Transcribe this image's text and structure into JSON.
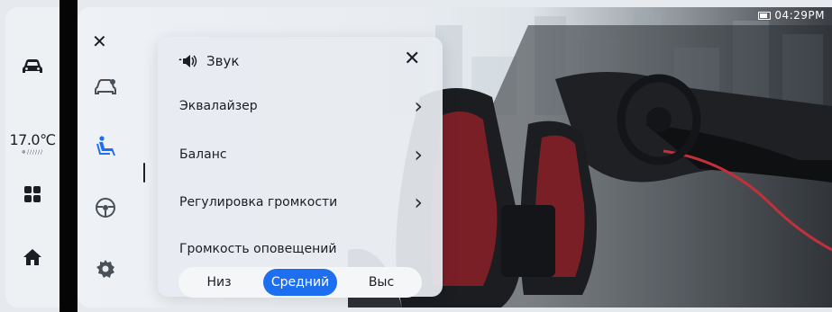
{
  "status_bar": {
    "time": "04:29PM",
    "battery_icon": "battery-icon"
  },
  "dock": {
    "items": [
      {
        "name": "car-icon"
      },
      {
        "name": "apps-grid-icon"
      },
      {
        "name": "home-icon"
      }
    ],
    "temperature": "17.0℃",
    "temperature_sub": "❄//////"
  },
  "side_menu": {
    "close_icon": "close-icon",
    "items": [
      {
        "name": "vehicle-settings-icon"
      },
      {
        "name": "seat-icon"
      },
      {
        "name": "steering-wheel-icon"
      },
      {
        "name": "gear-icon"
      }
    ]
  },
  "sound_panel": {
    "title": "Звук",
    "close_label": "✕",
    "rows": [
      {
        "label": "Эквалайзер"
      },
      {
        "label": "Баланс"
      },
      {
        "label": "Регулировка громкости"
      }
    ],
    "alerts_label": "Громкость оповещений",
    "alerts_options": [
      "Низ",
      "Средний",
      "Выс"
    ],
    "alerts_selected": "Средний"
  },
  "colors": {
    "accent": "#1d6ff0",
    "text": "#1b1e23"
  }
}
